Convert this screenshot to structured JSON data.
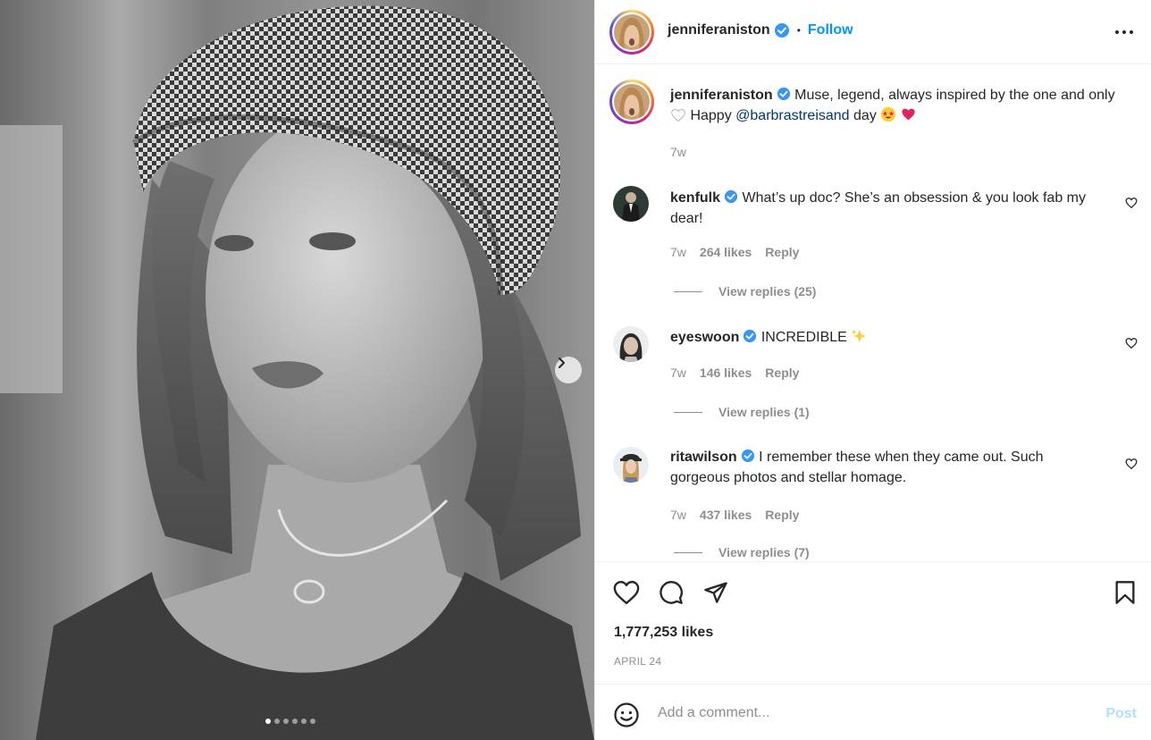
{
  "post": {
    "author": "jenniferaniston",
    "follow_label": "Follow",
    "separator": "•",
    "caption": {
      "username": "jenniferaniston",
      "text_1": "Muse, legend, always inspired by the one and only",
      "text_2": "Happy",
      "mention": "@barbrastreisand",
      "text_3": "day",
      "time": "7w"
    },
    "likes": "1,777,253 likes",
    "date": "APRIL 24",
    "carousel": {
      "count": 6,
      "active_index": 0
    }
  },
  "comments": [
    {
      "username": "kenfulk",
      "text": "What’s up doc? She’s an obsession & you look fab my dear!",
      "time": "7w",
      "likes": "264 likes",
      "reply_label": "Reply",
      "view_replies": "View replies (25)"
    },
    {
      "username": "eyeswoon",
      "text": "INCREDIBLE",
      "time": "7w",
      "likes": "146 likes",
      "reply_label": "Reply",
      "view_replies": "View replies (1)"
    },
    {
      "username": "ritawilson",
      "text": "I remember these when they came out. Such gorgeous photos and stellar homage.",
      "time": "7w",
      "likes": "437 likes",
      "reply_label": "Reply",
      "view_replies": "View replies (7)"
    }
  ],
  "composer": {
    "placeholder": "Add a comment...",
    "post_label": "Post"
  },
  "icons": {
    "verified": "verified-badge-icon",
    "more": "more-options-icon",
    "like": "heart-icon",
    "comment": "comment-icon",
    "share": "share-icon",
    "save": "bookmark-icon",
    "emoji": "emoji-icon",
    "next": "chevron-right-icon"
  },
  "colors": {
    "link": "#0095f6",
    "mention": "#00376b",
    "muted": "#8e8e8e",
    "verified": "#3897f0",
    "post_disabled": "#b2dffc"
  }
}
